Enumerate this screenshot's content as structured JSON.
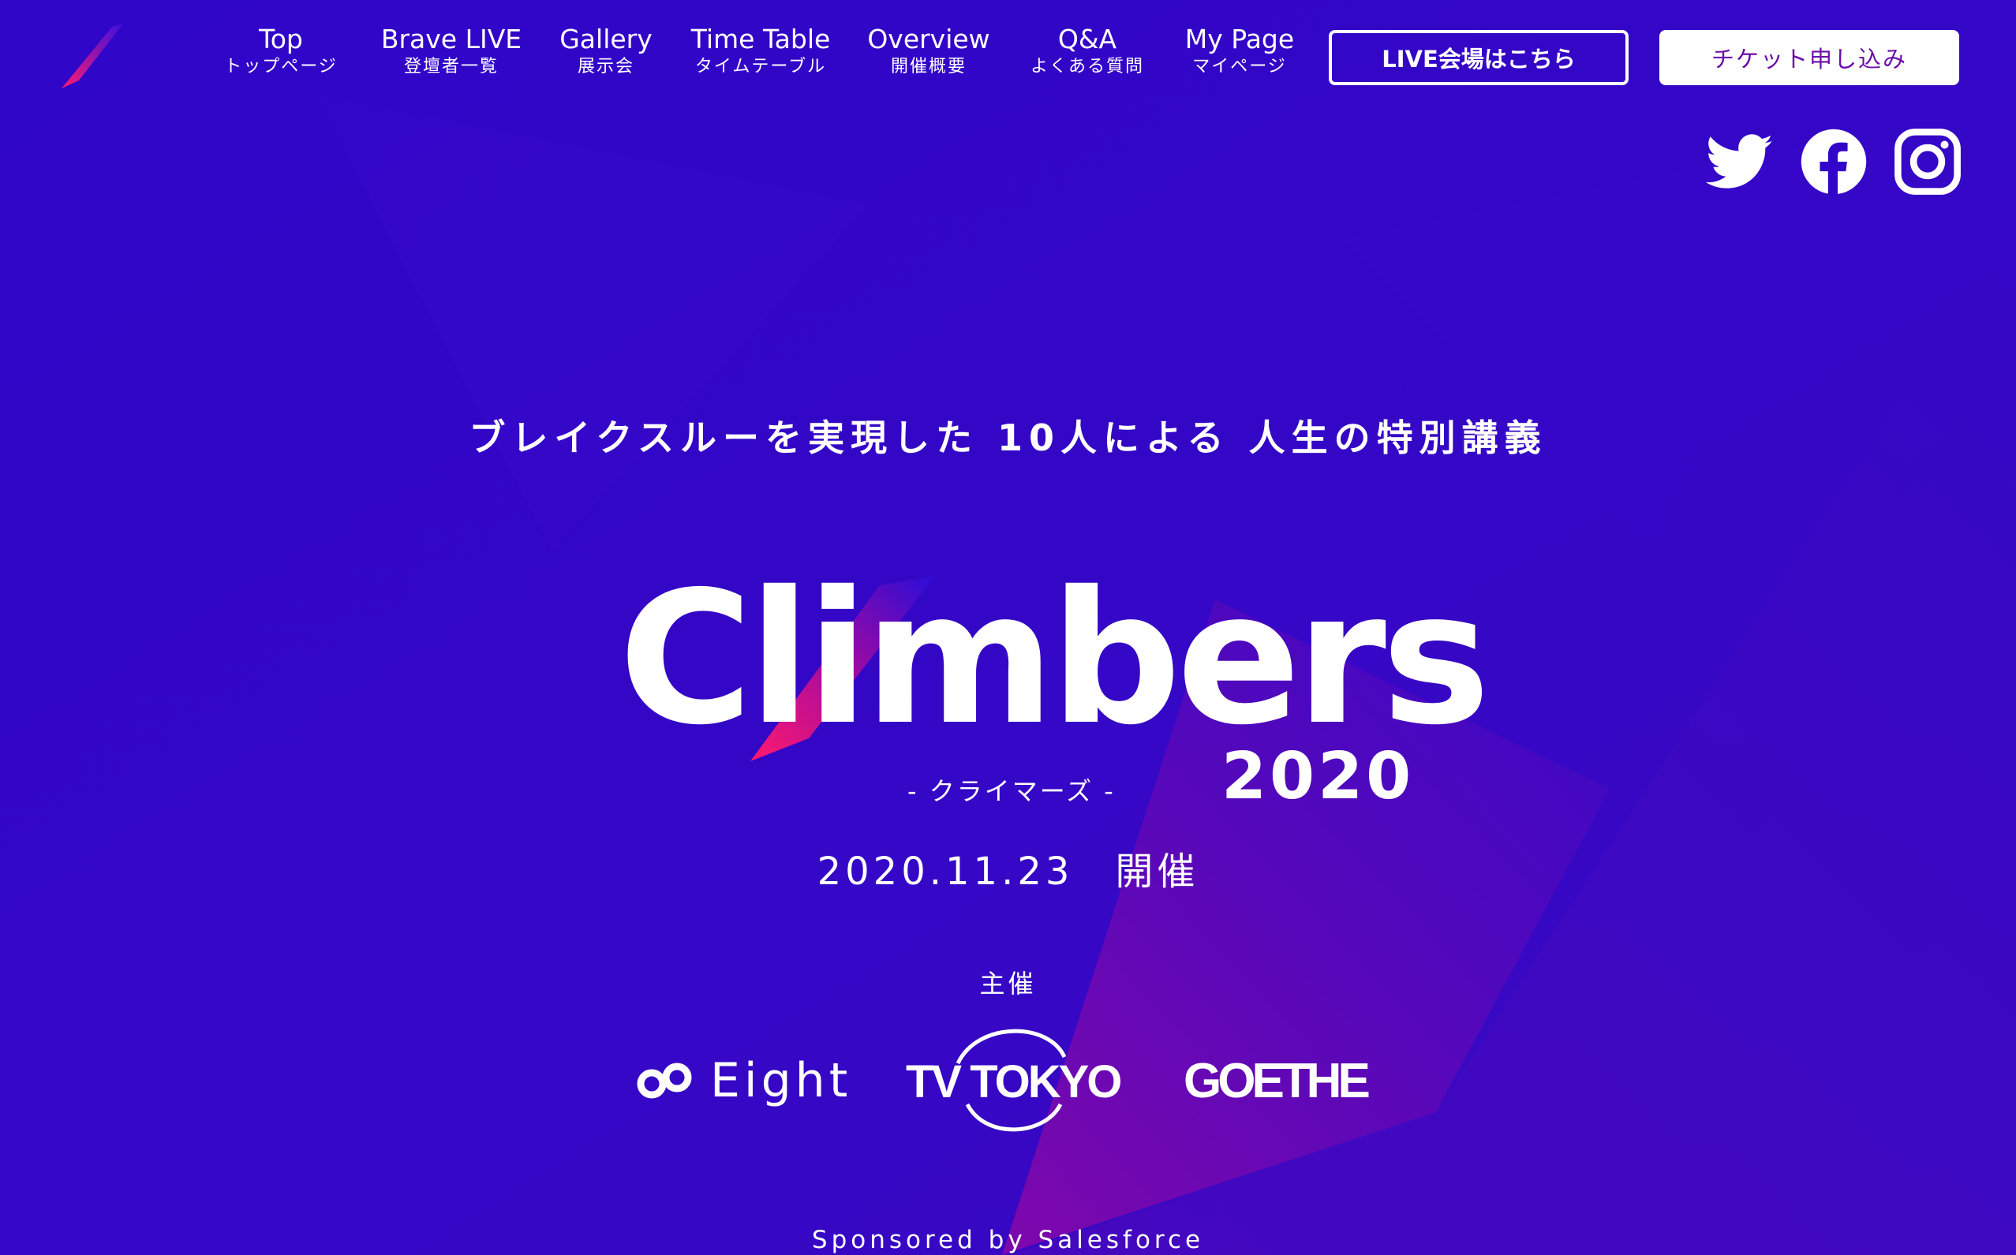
{
  "colors": {
    "background": "#2e06cc",
    "accent_pink": "#ff1a6e",
    "accent_purple": "#7a08a8",
    "ticket_text": "#6a0da8",
    "text": "#ffffff"
  },
  "header": {
    "logo_icon": "climbers-flag-icon",
    "nav": [
      {
        "label": "Top",
        "sub": "トップページ"
      },
      {
        "label": "Brave LIVE",
        "sub": "登壇者一覧"
      },
      {
        "label": "Gallery",
        "sub": "展示会"
      },
      {
        "label": "Time Table",
        "sub": "タイムテーブル"
      },
      {
        "label": "Overview",
        "sub": "開催概要"
      },
      {
        "label": "Q&A",
        "sub": "よくある質問"
      },
      {
        "label": "My Page",
        "sub": "マイページ"
      }
    ],
    "live_button": "LIVE会場はこちら",
    "ticket_button": "チケット申し込み"
  },
  "social": [
    {
      "name": "twitter",
      "icon": "twitter-icon"
    },
    {
      "name": "facebook",
      "icon": "facebook-icon"
    },
    {
      "name": "instagram",
      "icon": "instagram-icon"
    }
  ],
  "hero": {
    "tagline": "ブレイクスルーを実現した 10人による 人生の特別講義",
    "title": "Climbers",
    "year": "2020",
    "reading": "- クライマーズ -",
    "date": "2020.11.23　開催",
    "organizer_label": "主催",
    "organizers": [
      "Eight",
      "TV TOKYO",
      "GOETHE"
    ],
    "sponsor": "Sponsored by Salesforce"
  }
}
